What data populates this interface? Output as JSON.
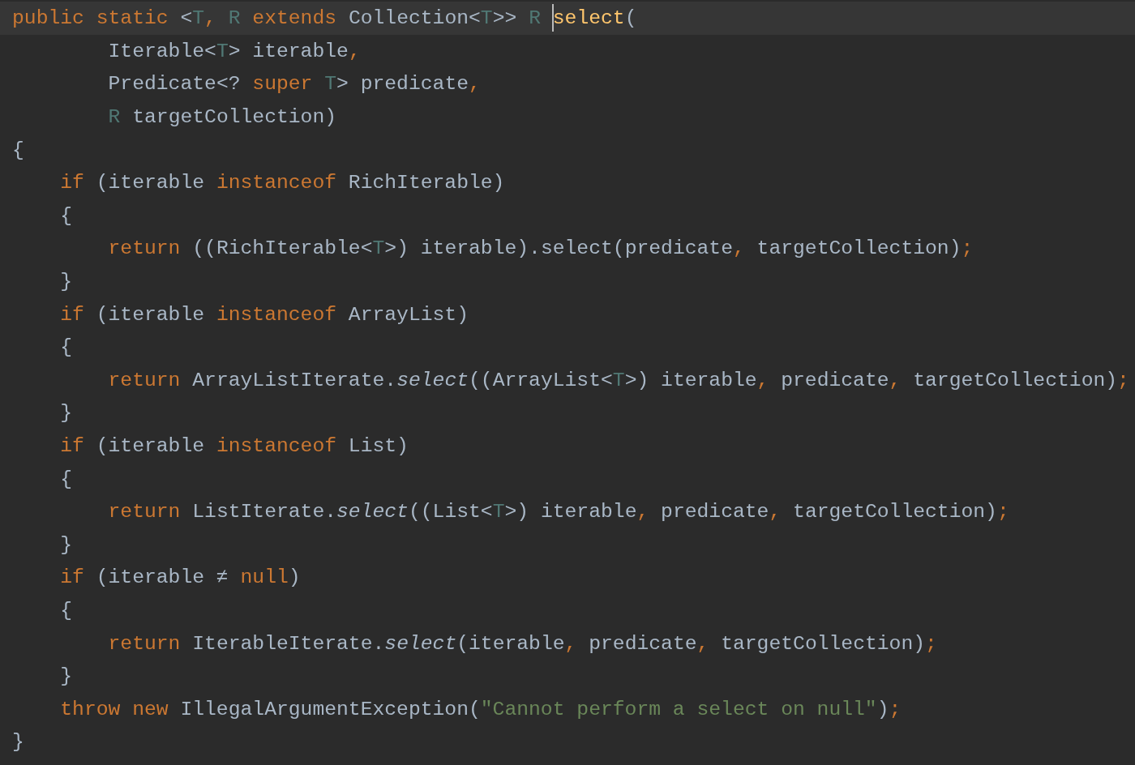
{
  "editor": {
    "lines": [
      {
        "kind": "code",
        "tokens": [
          {
            "kind": "kw",
            "text": "public static "
          },
          {
            "kind": "id",
            "text": "<"
          },
          {
            "kind": "tp",
            "text": "T"
          },
          {
            "kind": "punct",
            "text": ", "
          },
          {
            "kind": "tp",
            "text": "R "
          },
          {
            "kind": "kw",
            "text": "extends "
          },
          {
            "kind": "id",
            "text": "Collection<"
          },
          {
            "kind": "tp",
            "text": "T"
          },
          {
            "kind": "id",
            "text": ">> "
          },
          {
            "kind": "tp",
            "text": "R "
          },
          {
            "kind": "decl",
            "text": "select",
            "caret": true
          },
          {
            "kind": "id",
            "text": "("
          }
        ],
        "children": [
          {
            "kind": "continuation",
            "tokens": [
              {
                "kind": "id",
                "text": "Iterable<"
              },
              {
                "kind": "tp",
                "text": "T"
              },
              {
                "kind": "id",
                "text": "> iterable"
              },
              {
                "kind": "punct",
                "text": ","
              }
            ]
          },
          {
            "kind": "continuation",
            "tokens": [
              {
                "kind": "id",
                "text": "Predicate<? "
              },
              {
                "kind": "kw",
                "text": "super "
              },
              {
                "kind": "tp",
                "text": "T"
              },
              {
                "kind": "id",
                "text": "> predicate"
              },
              {
                "kind": "punct",
                "text": ","
              }
            ]
          },
          {
            "kind": "continuation",
            "tokens": [
              {
                "kind": "tp",
                "text": "R "
              },
              {
                "kind": "id",
                "text": "targetCollection)"
              }
            ]
          }
        ]
      },
      {
        "kind": "code",
        "tokens": [
          {
            "kind": "id",
            "text": "{"
          }
        ],
        "children": [
          {
            "kind": "code",
            "tokens": [
              {
                "kind": "kw",
                "text": "if "
              },
              {
                "kind": "id",
                "text": "(iterable "
              },
              {
                "kind": "kw",
                "text": "instanceof "
              },
              {
                "kind": "id",
                "text": "RichIterable)"
              }
            ]
          },
          {
            "kind": "code",
            "tokens": [
              {
                "kind": "id",
                "text": "{"
              }
            ],
            "children": [
              {
                "kind": "code",
                "tokens": [
                  {
                    "kind": "kw",
                    "text": "return "
                  },
                  {
                    "kind": "id",
                    "text": "((RichIterable<"
                  },
                  {
                    "kind": "tp",
                    "text": "T"
                  },
                  {
                    "kind": "id",
                    "text": ">) iterable).select(predicate"
                  },
                  {
                    "kind": "punct",
                    "text": ", "
                  },
                  {
                    "kind": "id",
                    "text": "targetCollection)"
                  },
                  {
                    "kind": "punct",
                    "text": ";"
                  }
                ]
              }
            ]
          },
          {
            "kind": "code",
            "tokens": [
              {
                "kind": "id",
                "text": "}"
              }
            ]
          },
          {
            "kind": "code",
            "tokens": [
              {
                "kind": "kw",
                "text": "if "
              },
              {
                "kind": "id",
                "text": "(iterable "
              },
              {
                "kind": "kw",
                "text": "instanceof "
              },
              {
                "kind": "id",
                "text": "ArrayList)"
              }
            ]
          },
          {
            "kind": "code",
            "tokens": [
              {
                "kind": "id",
                "text": "{"
              }
            ],
            "children": [
              {
                "kind": "code",
                "tokens": [
                  {
                    "kind": "kw",
                    "text": "return "
                  },
                  {
                    "kind": "id",
                    "text": "ArrayListIterate."
                  },
                  {
                    "kind": "static",
                    "text": "select"
                  },
                  {
                    "kind": "id",
                    "text": "((ArrayList<"
                  },
                  {
                    "kind": "tp",
                    "text": "T"
                  },
                  {
                    "kind": "id",
                    "text": ">) iterable"
                  },
                  {
                    "kind": "punct",
                    "text": ", "
                  },
                  {
                    "kind": "id",
                    "text": "predicate"
                  },
                  {
                    "kind": "punct",
                    "text": ", "
                  },
                  {
                    "kind": "id",
                    "text": "targetCollection)"
                  },
                  {
                    "kind": "punct",
                    "text": ";"
                  }
                ]
              }
            ]
          },
          {
            "kind": "code",
            "tokens": [
              {
                "kind": "id",
                "text": "}"
              }
            ]
          },
          {
            "kind": "code",
            "tokens": [
              {
                "kind": "kw",
                "text": "if "
              },
              {
                "kind": "id",
                "text": "(iterable "
              },
              {
                "kind": "kw",
                "text": "instanceof "
              },
              {
                "kind": "id",
                "text": "List)"
              }
            ]
          },
          {
            "kind": "code",
            "tokens": [
              {
                "kind": "id",
                "text": "{"
              }
            ],
            "children": [
              {
                "kind": "code",
                "tokens": [
                  {
                    "kind": "kw",
                    "text": "return "
                  },
                  {
                    "kind": "id",
                    "text": "ListIterate."
                  },
                  {
                    "kind": "static",
                    "text": "select"
                  },
                  {
                    "kind": "id",
                    "text": "((List<"
                  },
                  {
                    "kind": "tp",
                    "text": "T"
                  },
                  {
                    "kind": "id",
                    "text": ">) iterable"
                  },
                  {
                    "kind": "punct",
                    "text": ", "
                  },
                  {
                    "kind": "id",
                    "text": "predicate"
                  },
                  {
                    "kind": "punct",
                    "text": ", "
                  },
                  {
                    "kind": "id",
                    "text": "targetCollection)"
                  },
                  {
                    "kind": "punct",
                    "text": ";"
                  }
                ]
              }
            ]
          },
          {
            "kind": "code",
            "tokens": [
              {
                "kind": "id",
                "text": "}"
              }
            ]
          },
          {
            "kind": "code",
            "tokens": [
              {
                "kind": "kw",
                "text": "if "
              },
              {
                "kind": "id",
                "text": "(iterable ≠ "
              },
              {
                "kind": "kw",
                "text": "null"
              },
              {
                "kind": "id",
                "text": ")"
              }
            ]
          },
          {
            "kind": "code",
            "tokens": [
              {
                "kind": "id",
                "text": "{"
              }
            ],
            "children": [
              {
                "kind": "code",
                "tokens": [
                  {
                    "kind": "kw",
                    "text": "return "
                  },
                  {
                    "kind": "id",
                    "text": "IterableIterate."
                  },
                  {
                    "kind": "static",
                    "text": "select"
                  },
                  {
                    "kind": "id",
                    "text": "(iterable"
                  },
                  {
                    "kind": "punct",
                    "text": ", "
                  },
                  {
                    "kind": "id",
                    "text": "predicate"
                  },
                  {
                    "kind": "punct",
                    "text": ", "
                  },
                  {
                    "kind": "id",
                    "text": "targetCollection)"
                  },
                  {
                    "kind": "punct",
                    "text": ";"
                  }
                ]
              }
            ]
          },
          {
            "kind": "code",
            "tokens": [
              {
                "kind": "id",
                "text": "}"
              }
            ]
          },
          {
            "kind": "code",
            "tokens": [
              {
                "kind": "kw",
                "text": "throw new "
              },
              {
                "kind": "id",
                "text": "IllegalArgumentException("
              },
              {
                "kind": "str",
                "text": "\"Cannot perform a select on null\""
              },
              {
                "kind": "id",
                "text": ")"
              },
              {
                "kind": "punct",
                "text": ";"
              }
            ]
          }
        ]
      },
      {
        "kind": "code",
        "tokens": [
          {
            "kind": "id",
            "text": "}"
          }
        ]
      }
    ]
  }
}
